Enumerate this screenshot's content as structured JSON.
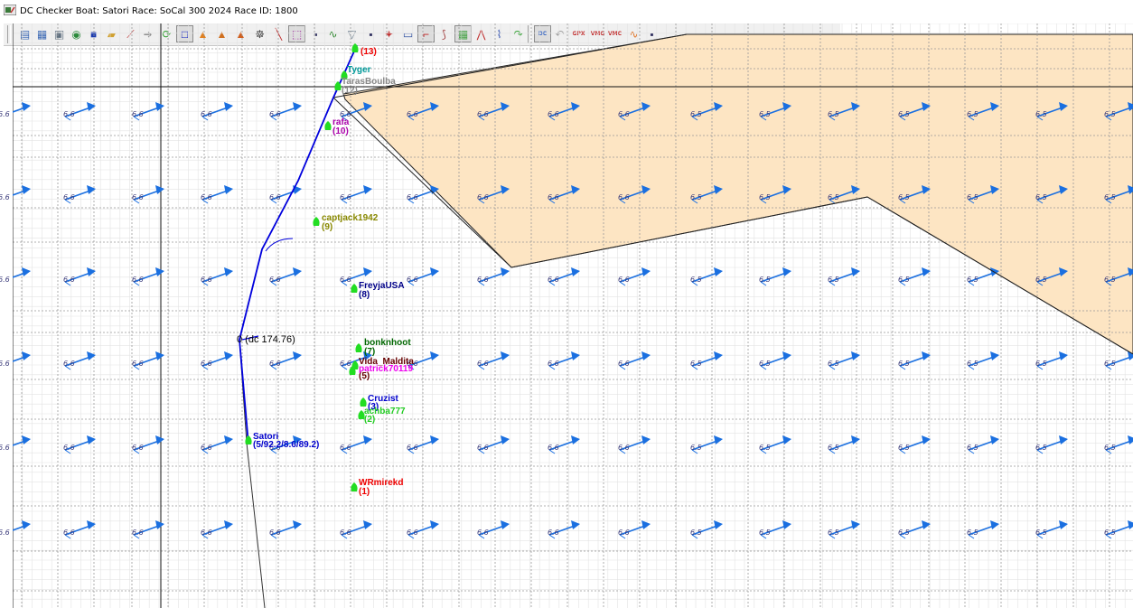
{
  "window": {
    "title": "DC Checker  Boat: Satori   Race: SoCal 300 2024   Race ID: 1800"
  },
  "toolbar": {
    "buttons": [
      {
        "name": "list-view-button",
        "glyph": "▤",
        "color": "#3060b0"
      },
      {
        "name": "table-view-button",
        "glyph": "▦",
        "color": "#3060b0"
      },
      {
        "name": "map-view-button",
        "glyph": "▣",
        "color": "#607080"
      },
      {
        "name": "globe-button",
        "glyph": "◉",
        "color": "#2a8a3a"
      },
      {
        "name": "color-fill-button",
        "glyph": "■",
        "color": "#1a3ab0"
      },
      {
        "name": "open-folder-button",
        "glyph": "▰",
        "color": "#d0a030"
      },
      {
        "name": "wind-barb-button",
        "glyph": "⟋",
        "color": "#c04040"
      },
      {
        "name": "arrow-right-button",
        "glyph": "➜",
        "color": "#909090"
      },
      {
        "name": "refresh-button",
        "glyph": "⟳",
        "color": "#30a030"
      },
      {
        "name": "square-button",
        "glyph": "□",
        "color": "#1020c0"
      },
      {
        "name": "warning-button",
        "glyph": "▲",
        "color": "#e08020"
      },
      {
        "name": "warning-rocks-button",
        "glyph": "▲",
        "color": "#d07020"
      },
      {
        "name": "warning-fog-button",
        "glyph": "▲",
        "color": "#d06020"
      },
      {
        "name": "helm-button",
        "glyph": "☸",
        "color": "#404040"
      },
      {
        "name": "draw-line-button",
        "glyph": "╲",
        "color": "#c03030"
      },
      {
        "name": "waypoint-button",
        "glyph": "⬚",
        "color": "#a030a0"
      },
      {
        "name": "save-button",
        "glyph": "▪",
        "color": "#303060"
      },
      {
        "name": "route-button",
        "glyph": "∿",
        "color": "#208020"
      },
      {
        "name": "filter-button",
        "glyph": "▽",
        "color": "#708090"
      },
      {
        "name": "save-route-button",
        "glyph": "▪",
        "color": "#303060"
      },
      {
        "name": "wand-button",
        "glyph": "✦",
        "color": "#c03030"
      },
      {
        "name": "text-box-button",
        "glyph": "▭",
        "color": "#3050a0"
      },
      {
        "name": "position-button",
        "glyph": "⌐",
        "color": "#c02020"
      },
      {
        "name": "isochrone-button",
        "glyph": "⟆",
        "color": "#a04040"
      },
      {
        "name": "grid-toggle-button",
        "glyph": "▦",
        "color": "#40a040"
      },
      {
        "name": "polar-button",
        "glyph": "⋀",
        "color": "#c03030"
      },
      {
        "name": "chart-button",
        "glyph": "⌇",
        "color": "#3050b0"
      },
      {
        "name": "redo-button",
        "glyph": "↷",
        "color": "#30a030"
      },
      {
        "name": "dc-button",
        "glyph": "DC",
        "color": "#3060c0"
      },
      {
        "name": "undo-button",
        "glyph": "↶",
        "color": "#a0a0a0"
      },
      {
        "name": "gpx-export-button",
        "glyph": "GPX",
        "color": "#c02020"
      },
      {
        "name": "vmg-button",
        "glyph": "VMG",
        "color": "#c02020"
      },
      {
        "name": "vmc-button",
        "glyph": "VMC",
        "color": "#c02020"
      },
      {
        "name": "compare-routes-button",
        "glyph": "∿",
        "color": "#e07020"
      },
      {
        "name": "save-all-button",
        "glyph": "▪",
        "color": "#303060"
      }
    ]
  },
  "map": {
    "colors": {
      "land": "#fde5c3",
      "grid_dotted": "#999999",
      "grid_minor": "#e3e3e3",
      "route": "#0000dd",
      "track": "#333333",
      "boat": "#22dd22",
      "wind_arrow": "#1a6fe0"
    },
    "wind_labels": {
      "row1": [
        "6.6",
        "6.6",
        "6.6",
        "6.6",
        "6.6",
        "6.6",
        "6.6",
        "6.6",
        "6.6",
        "6.6",
        "6.5",
        "6.5",
        "6.5",
        "6.5",
        "6.5",
        "6.5",
        "6.5"
      ],
      "row2": [
        "6.6",
        "6.6",
        "6.6",
        "6.6",
        "6.6",
        "6.6",
        "6.6",
        "6.6",
        "6.6",
        "6.6",
        "6.5",
        "6.5",
        "6.5",
        "6.5",
        "6.5",
        "6.5",
        "6.5"
      ],
      "row3": [
        "6.6",
        "6.6",
        "6.6",
        "6.6",
        "6.6",
        "6.6",
        "6.6",
        "6.6",
        "6.6",
        "6.6",
        "6.5",
        "6.5",
        "6.5",
        "6.5",
        "6.5",
        "6.5",
        "6.5"
      ],
      "row4": [
        "6.6",
        "6.6",
        "6.6",
        "6.6",
        "6.6",
        "6.6",
        "6.6",
        "6.6",
        "6.6",
        "6.6",
        "6.5",
        "6.5",
        "6.5",
        "6.5",
        "6.5",
        "6.5",
        "6.5"
      ],
      "row5": [
        "6.6",
        "6.6",
        "6.6",
        "6.6",
        "6.6",
        "6.6",
        "6.6",
        "6.6",
        "6.6",
        "6.6",
        "6.5",
        "6.5",
        "6.5",
        "6.5",
        "6.5",
        "6.5",
        "6.5"
      ],
      "row6": [
        "6.6",
        "6.6",
        "6.6",
        "6.6",
        "6.6",
        "6.6",
        "6.6",
        "6.6",
        "6.6",
        "6.6",
        "6.5",
        "6.5",
        "6.5",
        "6.5",
        "6.5",
        "6.5",
        "6.5"
      ]
    },
    "boats": [
      {
        "name": "(13)",
        "rank": "",
        "color": "#ee0000"
      },
      {
        "name": "Tyger",
        "rank": "",
        "color": "#009999"
      },
      {
        "name": "TarasBoulba",
        "rank": "(12)",
        "color": "#888888"
      },
      {
        "name": "rafa",
        "rank": "(10)",
        "color": "#aa00aa"
      },
      {
        "name": "captjack1942",
        "rank": "(9)",
        "color": "#888800"
      },
      {
        "name": "FreyjaUSA",
        "rank": "(8)",
        "color": "#000088"
      },
      {
        "name": "bonknhoot",
        "rank": "(7)",
        "color": "#006600"
      },
      {
        "name": "Vida_Maldita",
        "rank": "(5)",
        "color": "#660000"
      },
      {
        "name": "patrick70119",
        "rank": "(4)",
        "color": "#ee00ee"
      },
      {
        "name": "Cruzist",
        "rank": "(3)",
        "color": "#0000cc"
      },
      {
        "name": "achba777",
        "rank": "(2)",
        "color": "#22cc22"
      },
      {
        "name": "Satori",
        "rank": "(5/92.2/8.6/89.2)",
        "color": "#0000cc"
      },
      {
        "name": "WRmirekd",
        "rank": "(1)",
        "color": "#ee0000"
      }
    ],
    "dc_label": "0 (dc 174.76)"
  }
}
